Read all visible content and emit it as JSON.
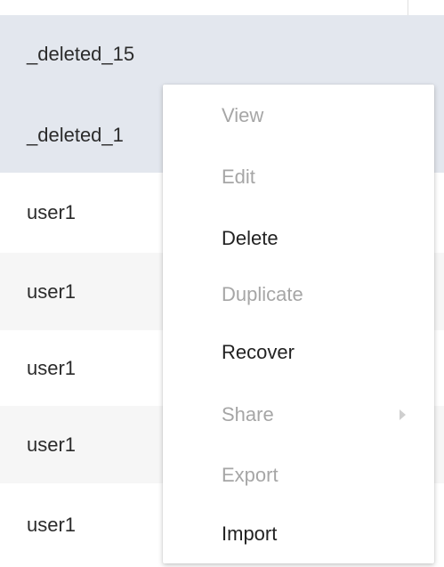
{
  "list": {
    "rows": [
      {
        "name": "_deleted_15",
        "selected": true
      },
      {
        "name": "_deleted_1",
        "selected": true
      },
      {
        "name": "user1",
        "selected": false
      },
      {
        "name": "user1",
        "selected": false
      },
      {
        "name": "user1",
        "selected": false
      },
      {
        "name": "user1",
        "selected": false
      },
      {
        "name": "user1",
        "selected": false
      }
    ]
  },
  "context_menu": {
    "items": [
      {
        "label": "View",
        "enabled": false
      },
      {
        "label": "Edit",
        "enabled": false
      },
      {
        "label": "Delete",
        "enabled": true
      },
      {
        "label": "Duplicate",
        "enabled": false
      },
      {
        "label": "Recover",
        "enabled": true
      },
      {
        "label": "Share",
        "enabled": false,
        "has_submenu": true
      },
      {
        "label": "Export",
        "enabled": false
      },
      {
        "label": "Import",
        "enabled": true
      }
    ]
  },
  "colors": {
    "selected_row": "#e3e7ee",
    "stripe_row": "#f6f6f6",
    "enabled_text": "#222222",
    "disabled_text": "#a6a6a6"
  },
  "icons": {
    "submenu_indicator": "chevron-right-icon"
  }
}
